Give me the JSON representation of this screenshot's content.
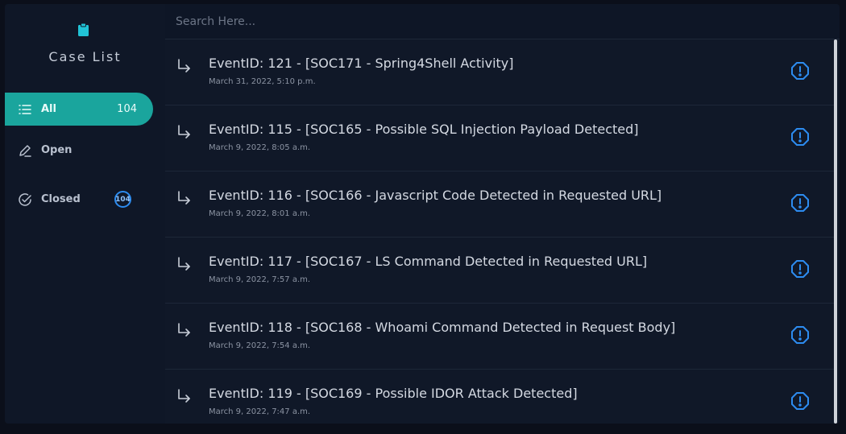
{
  "sidebar": {
    "title": "Case List",
    "items": [
      {
        "label": "All",
        "count": "104"
      },
      {
        "label": "Open",
        "count": ""
      },
      {
        "label": "Closed",
        "count": "104"
      }
    ]
  },
  "search": {
    "placeholder": "Search Here..."
  },
  "events": [
    {
      "title": "EventID: 121 - [SOC171 - Spring4Shell Activity]",
      "date": "March 31, 2022, 5:10 p.m."
    },
    {
      "title": "EventID: 115 - [SOC165 - Possible SQL Injection Payload Detected]",
      "date": "March 9, 2022, 8:05 a.m."
    },
    {
      "title": "EventID: 116 - [SOC166 - Javascript Code Detected in Requested URL]",
      "date": "March 9, 2022, 8:01 a.m."
    },
    {
      "title": "EventID: 117 - [SOC167 - LS Command Detected in Requested URL]",
      "date": "March 9, 2022, 7:57 a.m."
    },
    {
      "title": "EventID: 118 - [SOC168 - Whoami Command Detected in Request Body]",
      "date": "March 9, 2022, 7:54 a.m."
    },
    {
      "title": "EventID: 119 - [SOC169 - Possible IDOR Attack Detected]",
      "date": "March 9, 2022, 7:47 a.m."
    }
  ],
  "icons": {
    "header": "clipboard-icon",
    "all": "list-icon",
    "open": "pencil-icon",
    "closed": "check-circle-icon",
    "row": "arrow-return-icon",
    "alert": "alert-octagon-icon"
  },
  "colors": {
    "accent": "#1aa59d",
    "badge": "#2d8cf0",
    "alert": "#2d8cf0",
    "clipboard": "#21c3d6"
  }
}
